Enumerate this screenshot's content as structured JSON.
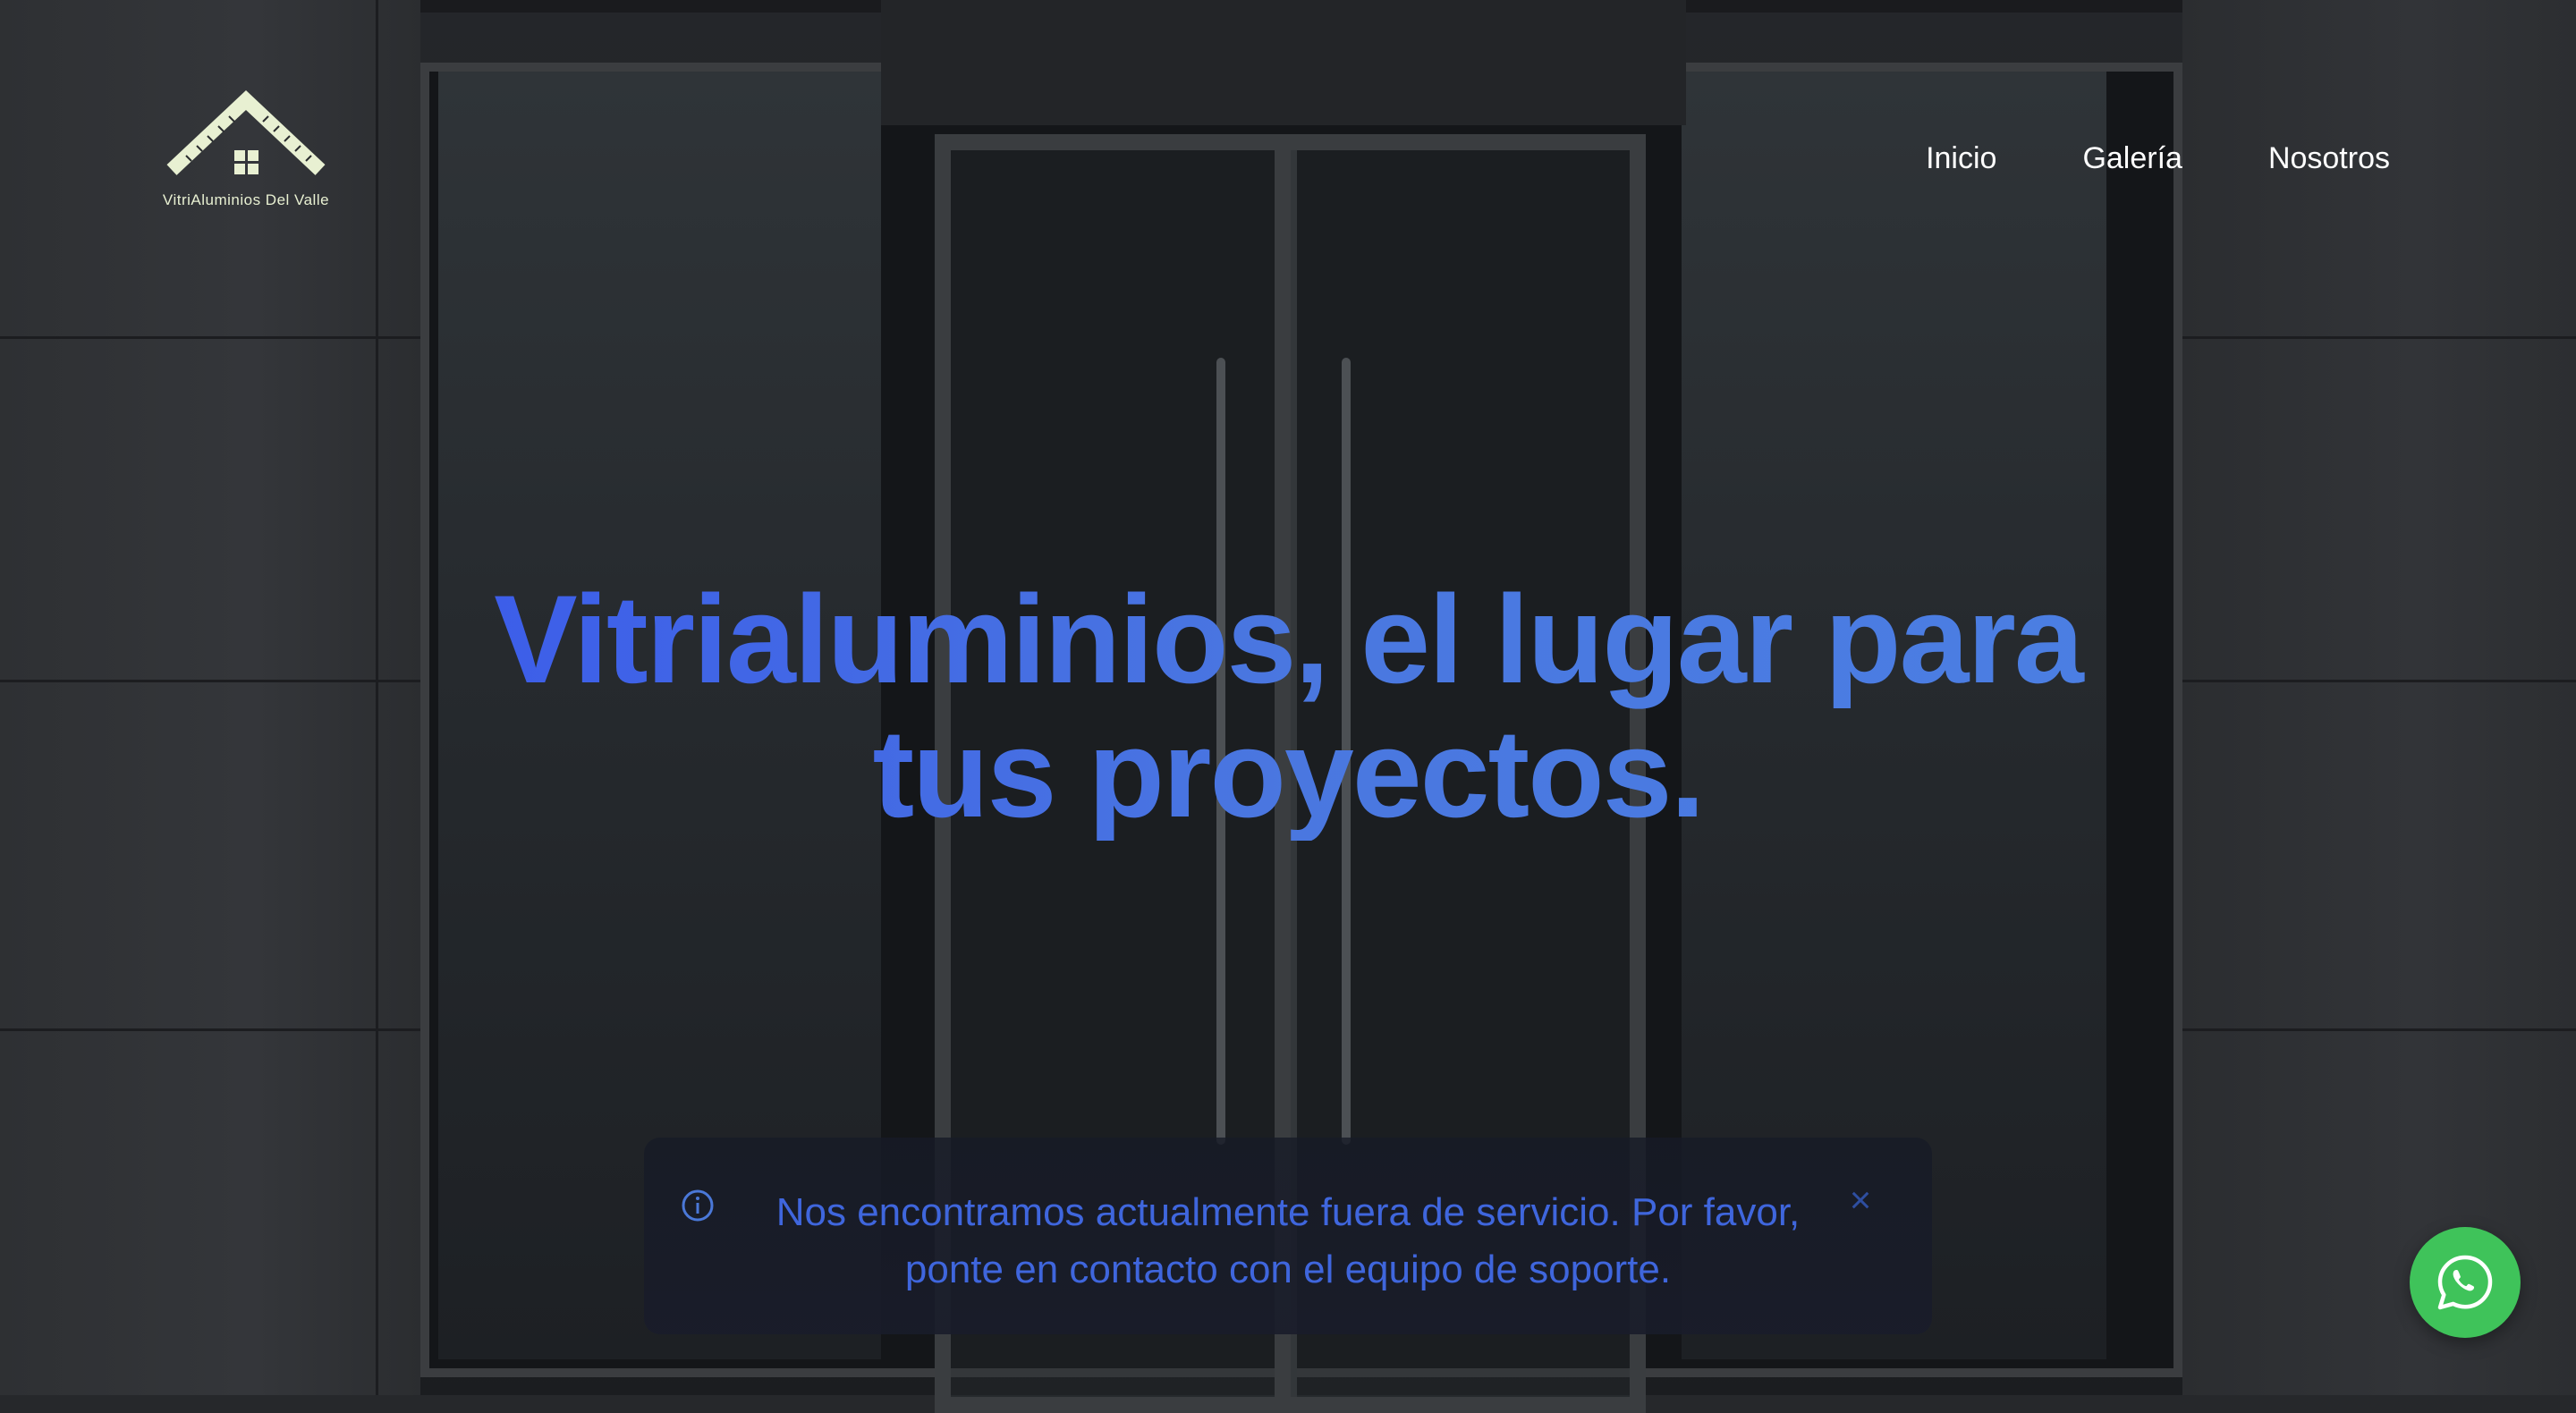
{
  "brand": {
    "name": "VitriAluminios Del Valle",
    "logo_icon": "house-roof-ruler-icon",
    "logo_color": "#e8f0d2"
  },
  "nav": {
    "items": [
      "Inicio",
      "Galería",
      "Nosotros"
    ]
  },
  "hero": {
    "headline_line1": "Vitrialuminios, el lugar para",
    "headline_line2": "tus proyectos.",
    "headline_color": "#3f66dd"
  },
  "alert": {
    "icon": "info-circle-icon",
    "message": "Nos encontramos actualmente fuera de servicio. Por favor, ponte en contacto con el equipo de soporte.",
    "close_icon": "close-icon",
    "text_color": "#3f66dd"
  },
  "floating": {
    "icon": "whatsapp-icon",
    "color": "#3fc35a"
  }
}
